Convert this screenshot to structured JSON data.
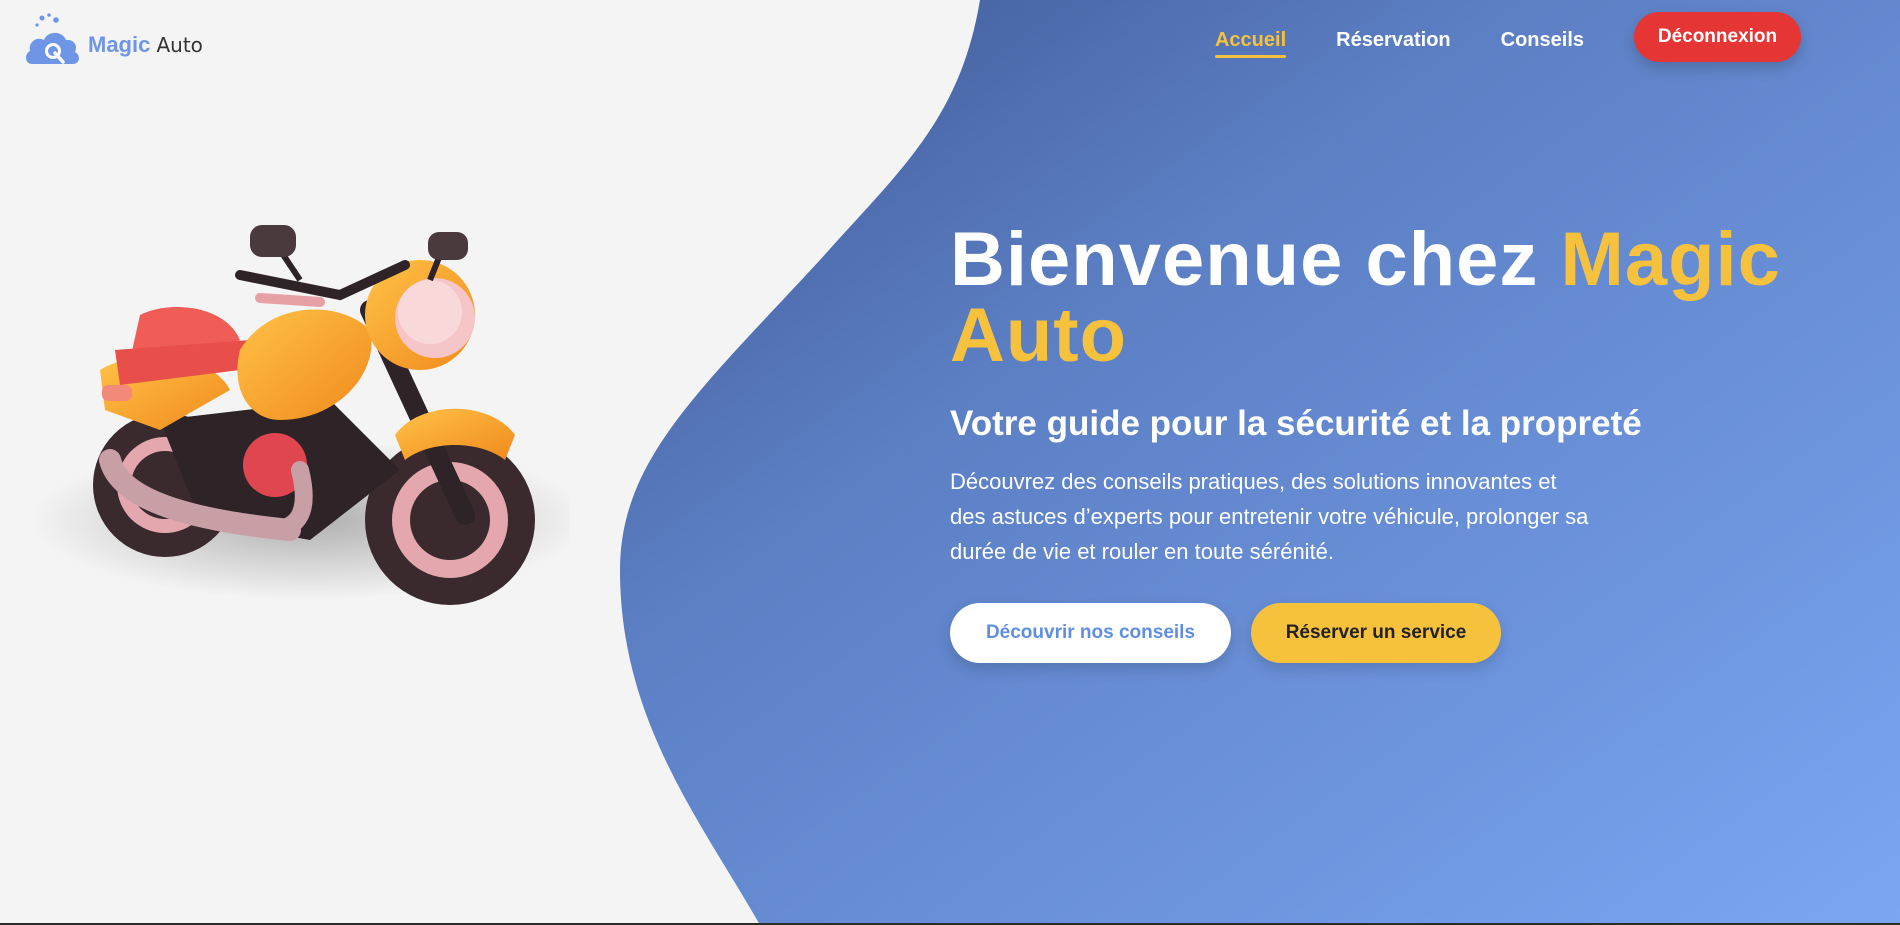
{
  "header": {
    "logo": {
      "primary": "Magic",
      "secondary": "Auto"
    },
    "nav": [
      {
        "label": "Accueil",
        "active": true
      },
      {
        "label": "Réservation",
        "active": false
      },
      {
        "label": "Conseils",
        "active": false
      }
    ],
    "logout_label": "Déconnexion"
  },
  "hero": {
    "title_part1": "Bienvenue chez ",
    "title_accent": "Magic Auto",
    "subtitle": "Votre guide pour la sécurité et la propreté",
    "description": "Découvrez des conseils pratiques, des solutions innovantes et des astuces d’experts pour entretenir votre véhicule, prolonger sa durée de vie et rouler en toute sérénité.",
    "primary_button": "Découvrir nos conseils",
    "secondary_button": "Réserver un service"
  },
  "colors": {
    "background": "#f4f4f4",
    "gradient_dark": "#4a63a3",
    "gradient_light": "#77a2ee",
    "accent_yellow": "#f6c23e",
    "danger_red": "#e63535",
    "brand_blue": "#6f96e6"
  },
  "icons": {
    "logo": "cloud-bubbles-logo-icon",
    "hero_image": "motorcycle-illustration"
  }
}
